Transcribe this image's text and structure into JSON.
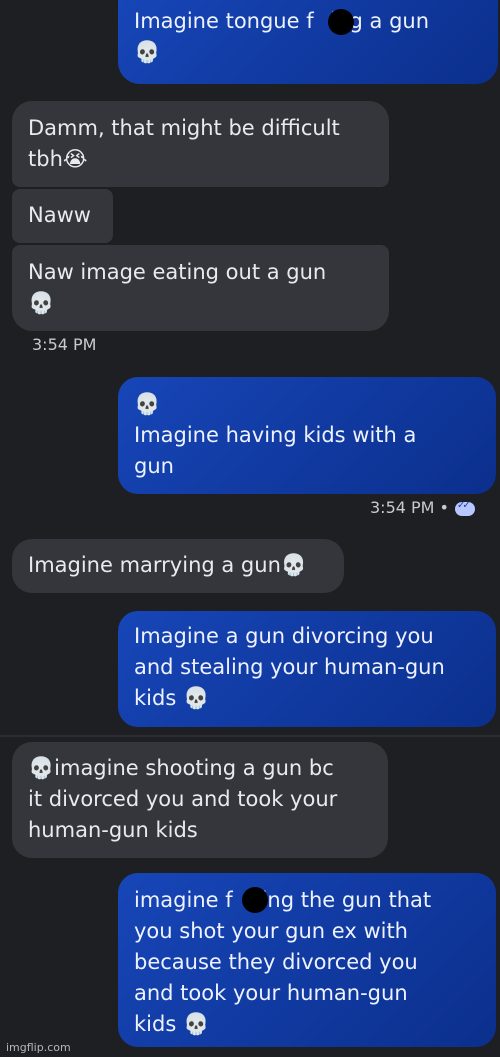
{
  "messages": [
    {
      "id": "m1",
      "dir": "out",
      "text": "Imagine tongue f    ing a gun\n💀"
    },
    {
      "id": "m2",
      "dir": "in",
      "text": "Damm, that might be difficult\ntbh😭"
    },
    {
      "id": "m3",
      "dir": "in",
      "text": "Naww"
    },
    {
      "id": "m4",
      "dir": "in",
      "text": "Naw image eating out a gun\n💀"
    },
    {
      "id": "m5",
      "dir": "out",
      "text": "💀\nImagine having kids with a\ngun"
    },
    {
      "id": "m6",
      "dir": "in",
      "text": "Imagine marrying a gun💀"
    },
    {
      "id": "m7",
      "dir": "out",
      "text": "Imagine a gun divorcing you\nand stealing your human-gun\nkids 💀"
    },
    {
      "id": "m8",
      "dir": "in",
      "text": "💀imagine shooting a gun bc\nit divorced you and took your\nhuman-gun kids"
    },
    {
      "id": "m9",
      "dir": "out",
      "text": "imagine f    king the gun that\nyou shot your gun ex with\nbecause they divorced you\nand took your human-gun\nkids 💀"
    }
  ],
  "timestamps": {
    "t1": "3:54 PM",
    "t2": "3:54 PM •"
  },
  "status": {
    "read_icon": "double-check-icon"
  },
  "watermark": "imgflip.com",
  "colors": {
    "background": "#1e1f23",
    "incoming": "#34363c",
    "outgoing": "#1746b8"
  }
}
